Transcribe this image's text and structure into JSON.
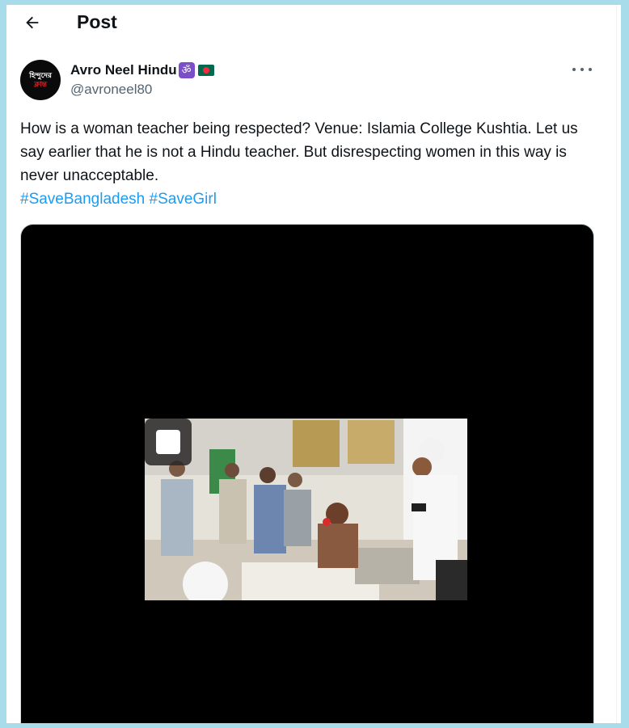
{
  "header": {
    "title": "Post",
    "back_icon": "arrow-left-icon"
  },
  "author": {
    "avatar_text_line1": "হিন্দুদের",
    "avatar_text_line2": "ক্লান্ত",
    "name": "Avro Neel Hindu",
    "badge_om": "ॐ",
    "flag": "bangladesh-flag-icon",
    "handle": "@avroneel80"
  },
  "more_icon": "more-options-icon",
  "tweet": {
    "text": "How is a woman teacher being respected? Venue: Islamia College Kushtia. Let us say earlier that he is not a Hindu teacher. But disrespecting women in this way is never unacceptable.",
    "hashtags": [
      "#SaveBangladesh",
      "#SaveGirl"
    ]
  },
  "media": {
    "type": "video",
    "control_icon": "stop-icon"
  },
  "colors": {
    "accent": "#1d9bf0",
    "text": "#0f1419",
    "muted": "#536471",
    "outer_bg": "#a9dcea"
  }
}
